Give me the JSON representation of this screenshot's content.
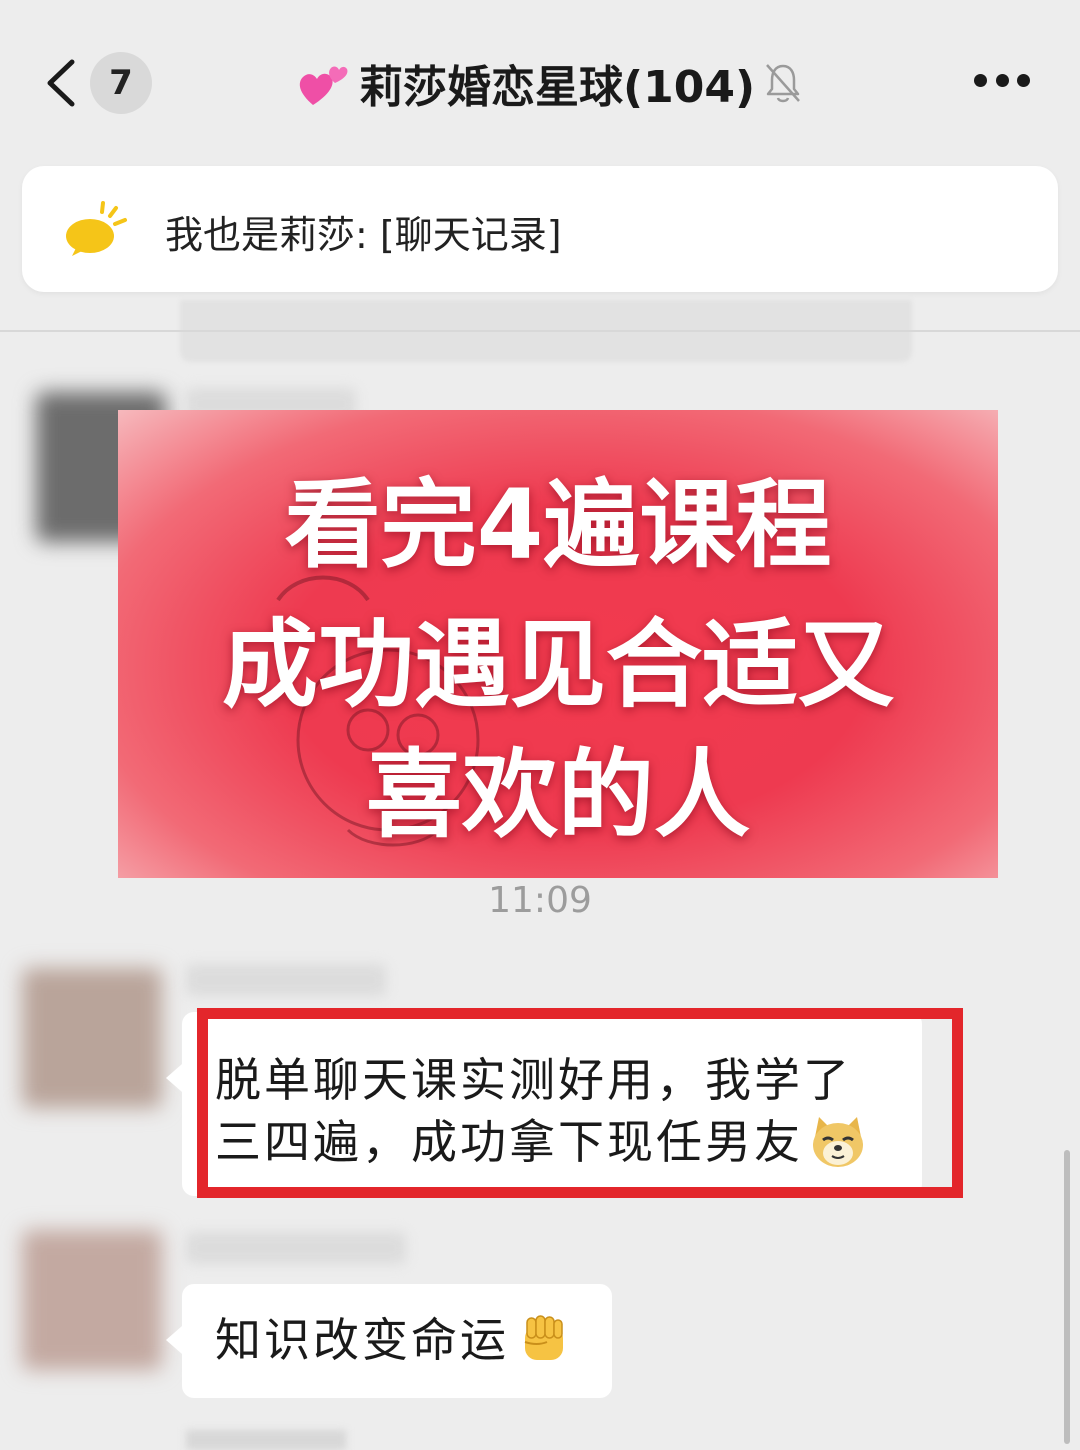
{
  "header": {
    "back_label": "<",
    "unread_count": "7",
    "group_name": "莉莎婚恋星球(104)",
    "emoji_icon": "two-hearts-icon",
    "mute_icon": "muted-bell-icon",
    "more_icon": "ellipsis-icon"
  },
  "pinned": {
    "icon": "announcement-icon",
    "text": "我也是莉莎: [聊天记录]"
  },
  "messages": {
    "image_banner": {
      "lines": [
        "看完4遍课程",
        "成功遇见合适又",
        "喜欢的人"
      ],
      "color": "#ee3a50"
    },
    "timestamp": "11:09",
    "msg1": {
      "line1": "脱单聊天课实测好用，我学了",
      "line2": "三四遍，成功拿下现任男友",
      "emoji": "doge-emoji",
      "highlight_color": "#e3262b"
    },
    "msg2": {
      "text": "知识改变命运",
      "emoji": "raised-fist-emoji"
    }
  }
}
